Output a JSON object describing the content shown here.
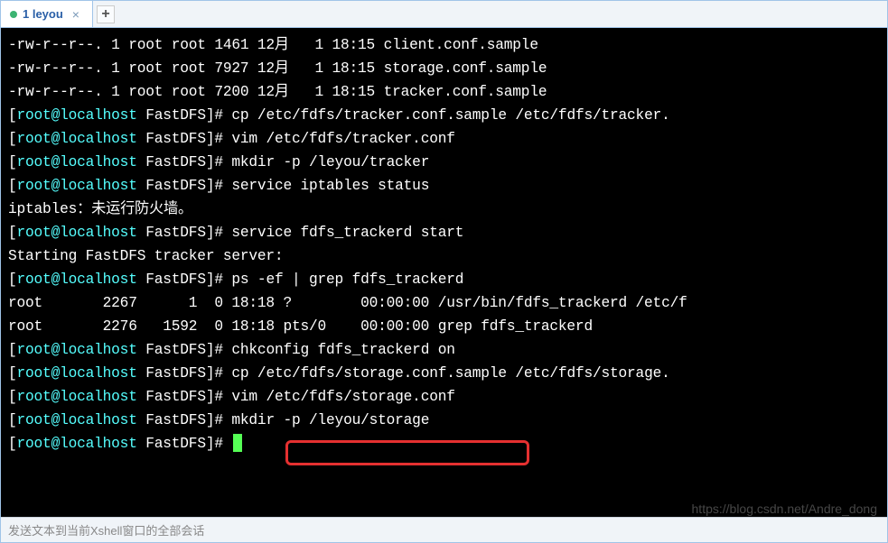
{
  "tab": {
    "indicator": "●",
    "title": "1 leyou",
    "close": "×",
    "new": "+"
  },
  "bottom": {
    "text": "发送文本到当前Xshell窗口的全部会话"
  },
  "watermark": "https://blog.csdn.net/Andre_dong",
  "prompt": {
    "user_host": "root@localhost",
    "dir": "FastDFS",
    "suffix": "]# "
  },
  "terminal": {
    "l1": "-rw-r--r--. 1 root root 1461 12月   1 18:15 client.conf.sample",
    "l2": "-rw-r--r--. 1 root root 7927 12月   1 18:15 storage.conf.sample",
    "l3": "-rw-r--r--. 1 root root 7200 12月   1 18:15 tracker.conf.sample",
    "c1": "cp /etc/fdfs/tracker.conf.sample /etc/fdfs/tracker.",
    "c2": "vim /etc/fdfs/tracker.conf",
    "c3": "mkdir -p /leyou/tracker",
    "c4": "service iptables status",
    "l4": "iptables：未运行防火墙。",
    "c5": "service fdfs_trackerd start",
    "l5": "Starting FastDFS tracker server:",
    "c6": "ps -ef | grep fdfs_trackerd",
    "l6": "root       2267      1  0 18:18 ?        00:00:00 /usr/bin/fdfs_trackerd /etc/f",
    "l7": "root       2276   1592  0 18:18 pts/0    00:00:00 grep fdfs_trackerd",
    "c7": "chkconfig fdfs_trackerd on",
    "c8": "cp /etc/fdfs/storage.conf.sample /etc/fdfs/storage.",
    "c9": "vim /etc/fdfs/storage.conf",
    "c10": "mkdir -p /leyou/storage"
  }
}
